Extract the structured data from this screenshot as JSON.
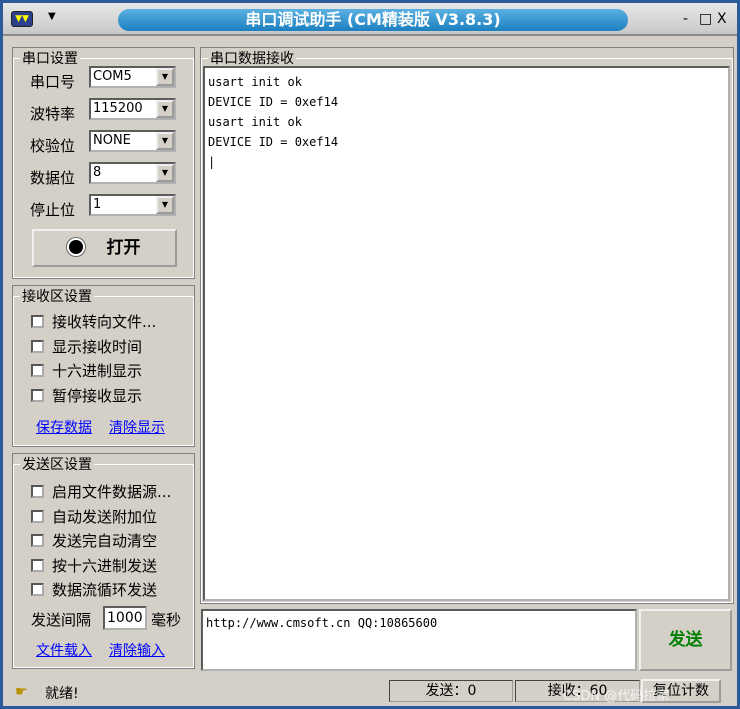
{
  "window": {
    "title": "串口调试助手 (CM精装版 V3.8.3)",
    "minimize": "-",
    "maximize": "□",
    "close": "X"
  },
  "serial": {
    "legend": "串口设置",
    "port_label": "串口号",
    "port": "COM5",
    "baud_label": "波特率",
    "baud": "115200",
    "parity_label": "校验位",
    "parity": "NONE",
    "databits_label": "数据位",
    "databits": "8",
    "stopbits_label": "停止位",
    "stopbits": "1",
    "open_label": "打开"
  },
  "receive": {
    "legend": "接收区设置",
    "options": [
      {
        "label": "接收转向文件...",
        "checked": false
      },
      {
        "label": "显示接收时间",
        "checked": false
      },
      {
        "label": "十六进制显示",
        "checked": false
      },
      {
        "label": "暂停接收显示",
        "checked": false
      }
    ],
    "save": "保存数据",
    "clear": "清除显示"
  },
  "send": {
    "legend": "发送区设置",
    "options": [
      {
        "label": "启用文件数据源...",
        "checked": false
      },
      {
        "label": "自动发送附加位",
        "checked": false
      },
      {
        "label": "发送完自动清空",
        "checked": false
      },
      {
        "label": "按十六进制发送",
        "checked": false
      },
      {
        "label": "数据流循环发送",
        "checked": false
      }
    ],
    "interval_label": "发送间隔",
    "interval": "1000",
    "interval_unit": "毫秒",
    "load": "文件载入",
    "clear": "清除输入"
  },
  "rx_area": {
    "legend": "串口数据接收",
    "text": "usart init ok\nDEVICE ID = 0xef14\nusart init ok\nDEVICE ID = 0xef14\n|"
  },
  "tx_area": {
    "text": "http://www.cmsoft.cn QQ:10865600",
    "send_button": "发送",
    "send_color": "#008000"
  },
  "statusbar": {
    "ready": "就绪!",
    "sent": "发送：0",
    "received": "接收：60",
    "reset": "复位计数",
    "watermark": "CSDN @代码拉家"
  }
}
